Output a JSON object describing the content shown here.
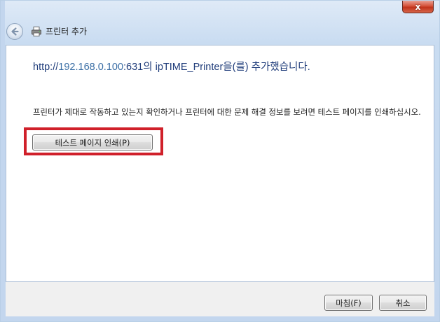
{
  "window": {
    "close_label": "x",
    "title": "프린터 추가"
  },
  "main": {
    "heading_prefix": "http://",
    "heading_ip": "192.168.0.100",
    "heading_suffix": ":631의 ipTIME_Printer을(를) 추가했습니다.",
    "description": "프린터가 제대로 작동하고 있는지 확인하거나 프린터에 대한 문제 해결 정보를 보려면 테스트 페이지를 인쇄하십시오.",
    "print_test_page_label": "테스트 페이지 인쇄(P)"
  },
  "footer": {
    "finish_label": "마침(F)",
    "cancel_label": "취소"
  },
  "icons": {
    "back": "back-arrow-icon",
    "printer": "printer-icon",
    "close": "close-icon"
  },
  "colors": {
    "highlight_box": "#d0202a",
    "heading_text": "#1f3c7a"
  }
}
